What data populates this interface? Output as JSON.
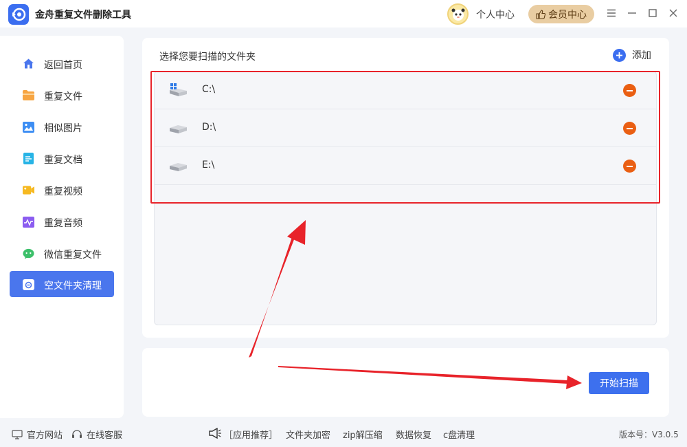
{
  "app": {
    "title": "金舟重复文件删除工具"
  },
  "header": {
    "personal_center": "个人中心",
    "vip_center": "会员中心"
  },
  "sidebar": {
    "items": [
      {
        "label": "返回首页",
        "icon": "home-icon",
        "active": false
      },
      {
        "label": "重复文件",
        "icon": "folder-icon",
        "active": false
      },
      {
        "label": "相似图片",
        "icon": "image-icon",
        "active": false
      },
      {
        "label": "重复文档",
        "icon": "document-icon",
        "active": false
      },
      {
        "label": "重复视频",
        "icon": "video-icon",
        "active": false
      },
      {
        "label": "重复音频",
        "icon": "audio-icon",
        "active": false
      },
      {
        "label": "微信重复文件",
        "icon": "wechat-icon",
        "active": false
      },
      {
        "label": "空文件夹清理",
        "icon": "empty-folder-icon",
        "active": true
      }
    ]
  },
  "main": {
    "title": "选择您要扫描的文件夹",
    "add_label": "添加",
    "drives": [
      {
        "name": "C:\\",
        "icon": "windows-drive-icon"
      },
      {
        "name": "D:\\",
        "icon": "drive-icon"
      },
      {
        "name": "E:\\",
        "icon": "drive-icon"
      }
    ],
    "scan_button": "开始扫描"
  },
  "footer": {
    "website": "官方网站",
    "support": "在线客服",
    "recommend": "［应用推荐］",
    "links": [
      "文件夹加密",
      "zip解压缩",
      "数据恢复",
      "c盘清理"
    ],
    "version": "版本号：V3.0.5"
  },
  "colors": {
    "accent": "#3b6ef0",
    "remove": "#ea5f13",
    "highlight": "#e8232a",
    "vip": "#e9cda2"
  }
}
